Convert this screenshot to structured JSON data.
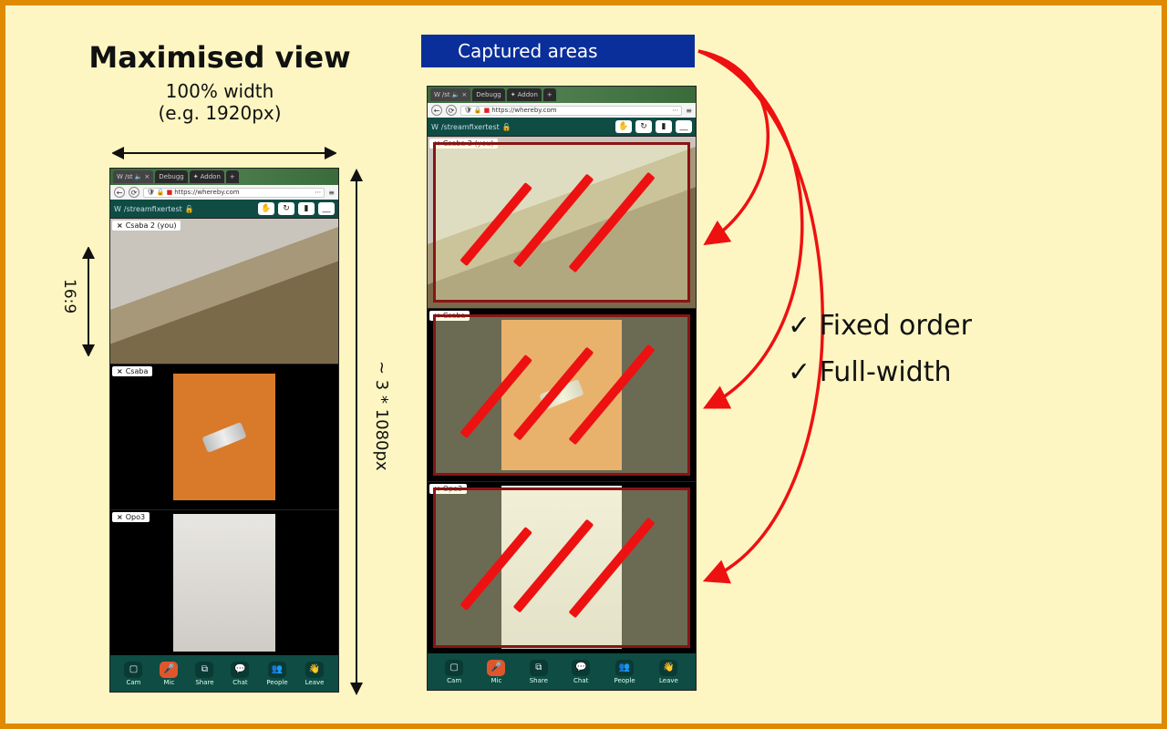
{
  "title": "Maximised view",
  "subtitle1": "100% width",
  "subtitle2": "(e.g. 1920px)",
  "height_label": "~ 3 * 1080px",
  "aspect_label": "16:9",
  "captured_label": "Captured areas",
  "bullets": {
    "b1": "Fixed order",
    "b2": "Full-width"
  },
  "app": {
    "tabs": {
      "t1": "/st",
      "t2": "Debugg",
      "t3": "Addon"
    },
    "url": "https://whereby.com",
    "room_name": "/streamfixertest",
    "participants": {
      "p1": "Csaba 2 (you)",
      "p2": "Csaba",
      "p3": "Opo3"
    },
    "bottom_bar": {
      "cam": "Cam",
      "mic": "Mic",
      "share": "Share",
      "chat": "Chat",
      "people": "People",
      "leave": "Leave"
    }
  }
}
